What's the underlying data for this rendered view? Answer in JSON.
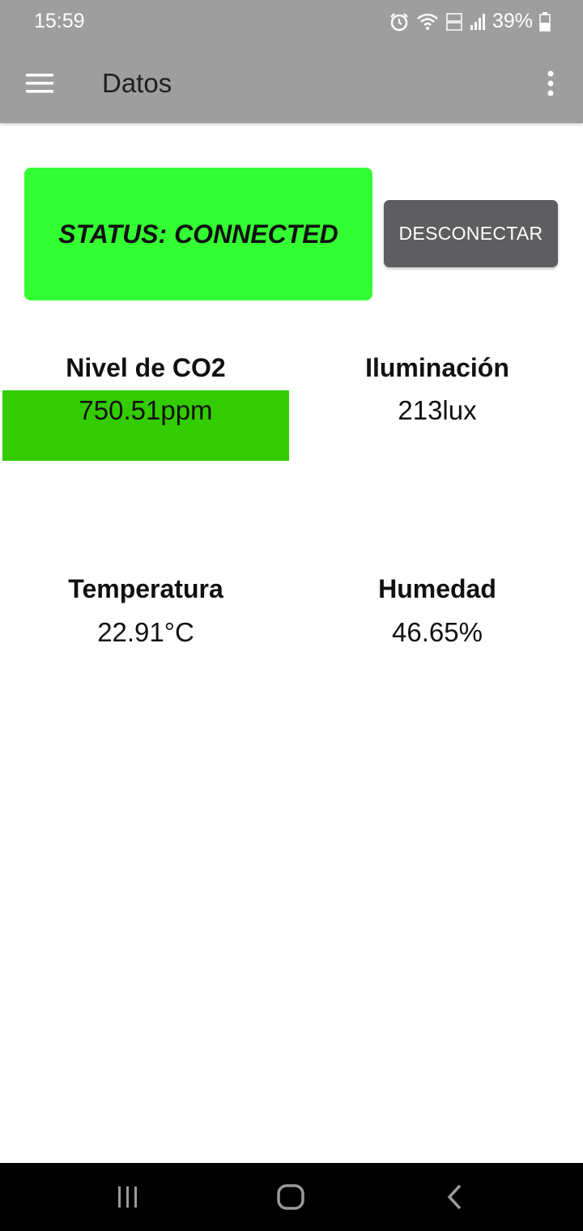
{
  "status_bar": {
    "time": "15:59",
    "battery": "39%",
    "icons": [
      "alarm-icon",
      "wifi-icon",
      "volte-icon",
      "signal-icon",
      "battery-icon"
    ]
  },
  "app_bar": {
    "title": "Datos",
    "icons": [
      "menu-icon",
      "overflow-menu-icon"
    ]
  },
  "connection": {
    "status_text": "STATUS: CONNECTED",
    "status_color": "#33ff33",
    "disconnect_label": "DESCONECTAR"
  },
  "metrics": {
    "co2": {
      "label": "Nivel de CO2",
      "value": "750.51ppm",
      "highlight_color": "#33cc00"
    },
    "illumination": {
      "label": "Iluminación",
      "value": "213lux"
    },
    "temperature": {
      "label": "Temperatura",
      "value": "22.91°C"
    },
    "humidity": {
      "label": "Humedad",
      "value": "46.65%"
    }
  },
  "nav_bar": {
    "icons": [
      "recent-apps-icon",
      "home-icon",
      "back-icon"
    ]
  }
}
